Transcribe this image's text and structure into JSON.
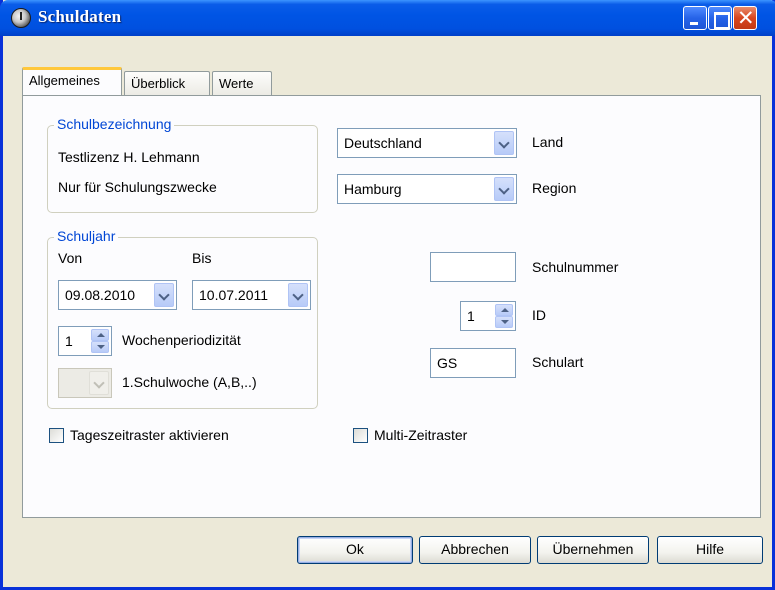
{
  "window": {
    "title": "Schuldaten"
  },
  "tabs": [
    {
      "label": "Allgemeines",
      "active": true
    },
    {
      "label": "Überblick",
      "active": false
    },
    {
      "label": "Werte",
      "active": false
    }
  ],
  "schulbezeichnung": {
    "title": "Schulbezeichnung",
    "line1": "Testlizenz H.  Lehmann",
    "line2": "Nur für Schulungszwecke"
  },
  "schuljahr": {
    "title": "Schuljahr",
    "von_label": "Von",
    "bis_label": "Bis",
    "von_value": "09.08.2010",
    "bis_value": "10.07.2011",
    "wochenperiodizitaet_value": "1",
    "wochenperiodizitaet_label": "Wochenperiodizität",
    "schulwoche_label": "1.Schulwoche (A,B,..)"
  },
  "land": {
    "value": "Deutschland",
    "label": "Land"
  },
  "region": {
    "value": "Hamburg",
    "label": "Region"
  },
  "schulnummer": {
    "value": "",
    "label": "Schulnummer"
  },
  "id_field": {
    "value": "1",
    "label": "ID"
  },
  "schulart": {
    "value": "GS",
    "label": "Schulart"
  },
  "checkboxes": {
    "tageszeitraster": {
      "label": "Tageszeitraster aktivieren",
      "checked": false
    },
    "multi_zeitraster": {
      "label": "Multi-Zeitraster",
      "checked": false
    }
  },
  "buttons": {
    "ok": "Ok",
    "abbrechen": "Abbrechen",
    "uebernehmen": "Übernehmen",
    "hilfe": "Hilfe"
  },
  "colors": {
    "titlebar": "#0055e5",
    "group_title": "#0046d5",
    "active_tab_accent": "#ffc83c",
    "dialog_bg": "#ece9d8"
  }
}
